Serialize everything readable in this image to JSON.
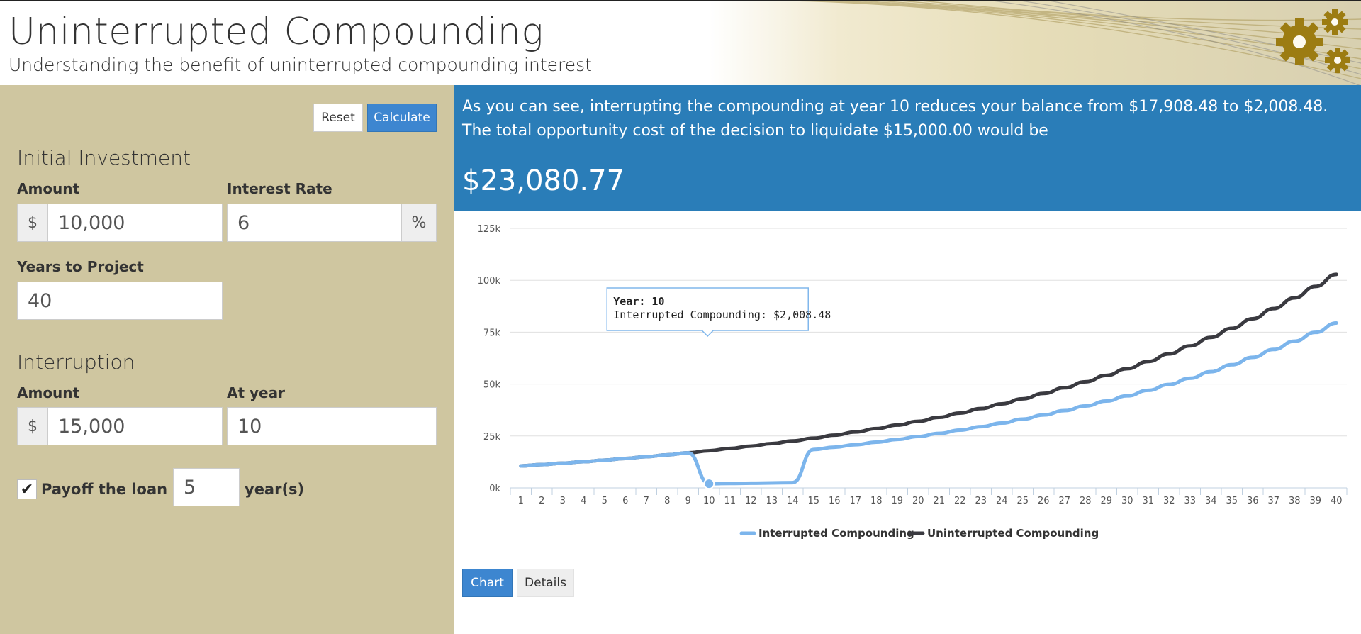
{
  "header": {
    "title": "Uninterrupted Compounding",
    "subtitle": "Understanding the benefit of uninterrupted compounding interest"
  },
  "toolbar": {
    "reset_label": "Reset",
    "calculate_label": "Calculate"
  },
  "initial_investment": {
    "section_title": "Initial Investment",
    "amount_label": "Amount",
    "amount_prefix": "$",
    "amount_value": "10,000",
    "rate_label": "Interest Rate",
    "rate_value": "6",
    "rate_suffix": "%",
    "years_label": "Years to Project",
    "years_value": "40"
  },
  "interruption": {
    "section_title": "Interruption",
    "amount_label": "Amount",
    "amount_prefix": "$",
    "amount_value": "15,000",
    "year_label": "At year",
    "year_value": "10",
    "payoff_checked": true,
    "payoff_label": "Payoff the loan in",
    "payoff_value": "5",
    "payoff_suffix": "year(s)"
  },
  "result": {
    "text": "As you can see, interrupting the compounding at year 10 reduces your balance from $17,908.48 to $2,008.48. The total opportunity cost of the decision to liquidate $15,000.00 would be",
    "value": "$23,080.77",
    "color": "#2a7db8"
  },
  "tabs": {
    "chart_label": "Chart",
    "details_label": "Details"
  },
  "chart_data": {
    "type": "line",
    "x": [
      1,
      2,
      3,
      4,
      5,
      6,
      7,
      8,
      9,
      10,
      11,
      12,
      13,
      14,
      15,
      16,
      17,
      18,
      19,
      20,
      21,
      22,
      23,
      24,
      25,
      26,
      27,
      28,
      29,
      30,
      31,
      32,
      33,
      34,
      35,
      36,
      37,
      38,
      39,
      40
    ],
    "y_ticks": [
      "0k",
      "25k",
      "50k",
      "75k",
      "100k",
      "125k"
    ],
    "ylim": [
      0,
      125000
    ],
    "grid": true,
    "legend_position": "bottom",
    "series": [
      {
        "name": "Interrupted Compounding",
        "color": "#7cb5ec",
        "values": [
          10600,
          11236,
          11910,
          12625,
          13382,
          14185,
          15036,
          15938,
          16895,
          2008,
          2129,
          2256,
          2392,
          2535,
          18500,
          19610,
          20786,
          22034,
          23356,
          24757,
          26242,
          27817,
          29486,
          31255,
          33130,
          35118,
          37225,
          39459,
          41826,
          44336,
          46996,
          49816,
          52805,
          55973,
          59332,
          62891,
          66665,
          70665,
          74905,
          79399
        ]
      },
      {
        "name": "Uninterrupted Compounding",
        "color": "#3a3a40",
        "values": [
          10600,
          11236,
          11910,
          12625,
          13382,
          14185,
          15036,
          15938,
          16895,
          17908,
          18983,
          20122,
          21329,
          22609,
          23966,
          25404,
          26928,
          28543,
          30256,
          32071,
          33996,
          36035,
          38197,
          40489,
          42919,
          45494,
          48223,
          51117,
          54184,
          57435,
          60881,
          64534,
          68406,
          72510,
          76861,
          81473,
          86361,
          91543,
          97035,
          102857
        ]
      }
    ],
    "tooltip": {
      "year_label": "Year:",
      "year_value": "10",
      "series_label": "Interrupted Compounding:",
      "series_value": "$2,008.48"
    }
  }
}
